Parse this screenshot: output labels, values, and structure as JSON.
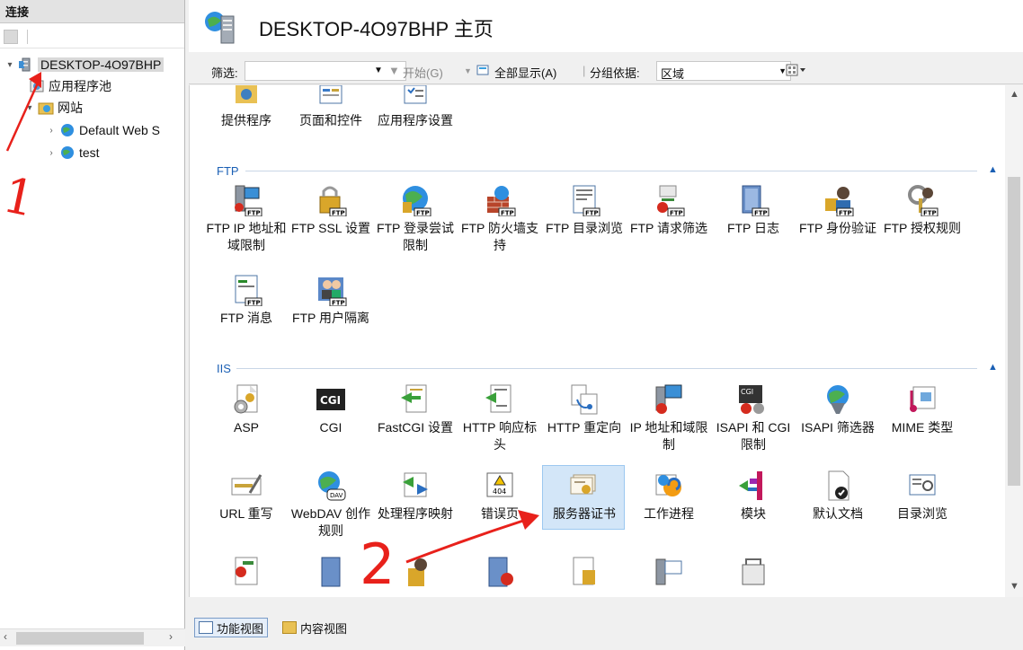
{
  "connections": {
    "title": "连接",
    "tree": [
      {
        "label": "DESKTOP-4O97BHP",
        "toggle": "▾",
        "selected": true
      },
      {
        "label": "应用程序池",
        "toggle": ""
      },
      {
        "label": "网站",
        "toggle": "▾"
      },
      {
        "label": "Default Web S",
        "toggle": "›"
      },
      {
        "label": "test",
        "toggle": "›"
      }
    ],
    "scroll_left": "‹",
    "scroll_right": "›"
  },
  "header": {
    "title": "DESKTOP-4O97BHP 主页"
  },
  "filterbar": {
    "filter_label": "筛选:",
    "start_label": "开始(G)",
    "show_all_label": "全部显示(A)",
    "group_by_label": "分组依据:",
    "group_value": "区域"
  },
  "top_row": [
    {
      "label": "提供程序"
    },
    {
      "label": "页面和控件"
    },
    {
      "label": "应用程序设置"
    }
  ],
  "groups": [
    {
      "name": "FTP",
      "items": [
        {
          "label": "FTP IP 地址和域限制"
        },
        {
          "label": "FTP SSL 设置"
        },
        {
          "label": "FTP 登录尝试限制"
        },
        {
          "label": "FTP 防火墙支持"
        },
        {
          "label": "FTP 目录浏览"
        },
        {
          "label": "FTP 请求筛选"
        },
        {
          "label": "FTP 日志"
        },
        {
          "label": "FTP 身份验证"
        },
        {
          "label": "FTP 授权规则"
        },
        {
          "label": "FTP 消息"
        },
        {
          "label": "FTP 用户隔离"
        }
      ]
    },
    {
      "name": "IIS",
      "items": [
        {
          "label": "ASP"
        },
        {
          "label": "CGI"
        },
        {
          "label": "FastCGI 设置"
        },
        {
          "label": "HTTP 响应标头"
        },
        {
          "label": "HTTP 重定向"
        },
        {
          "label": "IP 地址和域限制"
        },
        {
          "label": "ISAPI 和 CGI 限制"
        },
        {
          "label": "ISAPI 筛选器"
        },
        {
          "label": "MIME 类型"
        },
        {
          "label": "URL 重写"
        },
        {
          "label": "WebDAV 创作规则"
        },
        {
          "label": "处理程序映射"
        },
        {
          "label": "错误页"
        },
        {
          "label": "服务器证书",
          "selected": true
        },
        {
          "label": "工作进程"
        },
        {
          "label": "模块"
        },
        {
          "label": "默认文档"
        },
        {
          "label": "目录浏览"
        }
      ]
    }
  ],
  "icon_texts": {
    "ftp_tag": "FTP",
    "cgi": "CGI",
    "error_page": "404",
    "webdav": "DAV"
  },
  "bottom": {
    "features_view": "功能视图",
    "content_view": "内容视图"
  },
  "annotations": {
    "step_1": "1",
    "step_2": "2",
    "color": "#e8211b"
  }
}
